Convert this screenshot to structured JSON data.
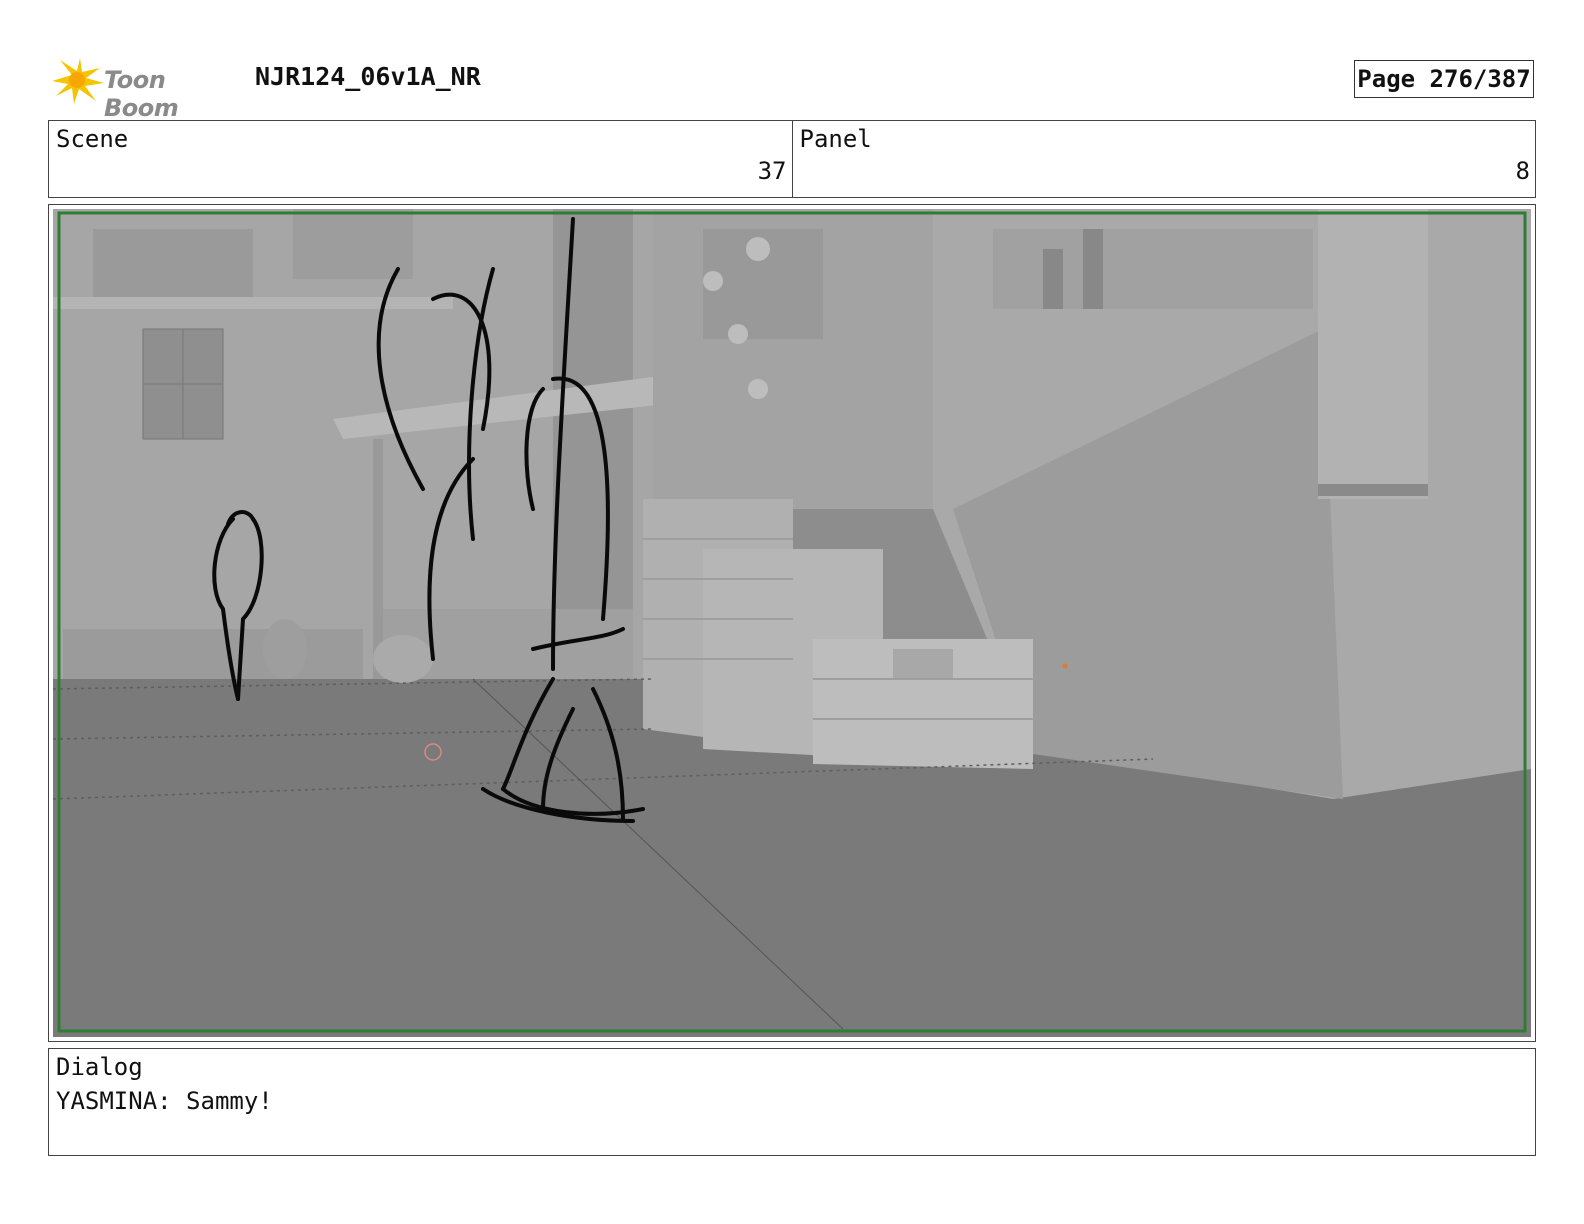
{
  "header": {
    "brand": "Toon Boom",
    "doc_title": "NJR124_06v1A_NR",
    "page": "Page 276/387"
  },
  "scene": {
    "label": "Scene",
    "value": "37"
  },
  "panel": {
    "label": "Panel",
    "value": "8"
  },
  "dialog": {
    "label": "Dialog",
    "text": "YASMINA: Sammy!"
  },
  "colors": {
    "frame_border": "#2e7d32",
    "render_gray": "#8d8d8d",
    "logo_yellow": "#f5c400"
  }
}
